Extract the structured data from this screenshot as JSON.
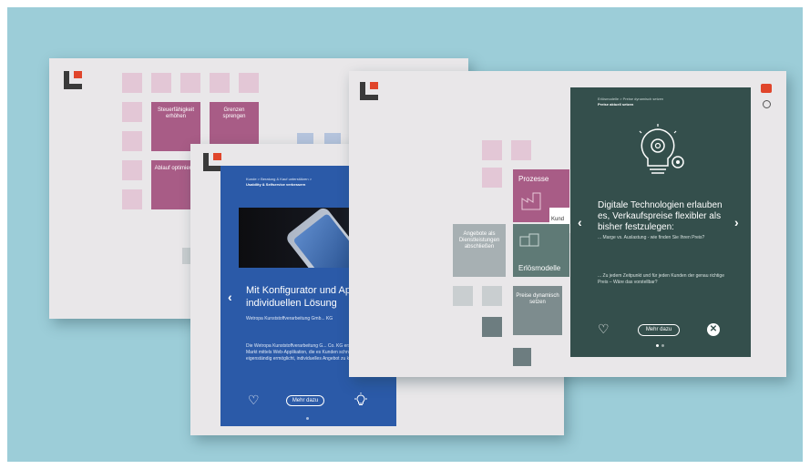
{
  "screen1": {
    "tiles": [
      "Steuerfähigkeit erhöhen",
      "Grenzen sprengen",
      "Ablauf optimieren"
    ]
  },
  "screen2": {
    "breadcrumb": "Kunde  >  Beratung & Kauf unterstützen  >",
    "breadcrumb_current": "Usability & Selfservice verbessern",
    "title": "Mit Konfigurator und App s... zur individuellen Lösung",
    "subtitle": "Wetropa Kunststoffverarbeitung Gmb... KG",
    "body": "Die Wetropa Kunststoffverarbeitung G... Co. KG erschließt den B2C Markt mittels Web-Applikation, die es Kunden schnell, bequem und eigenständig ermöglicht, individuelles Angebot zu konfigurieren...",
    "more_label": "Mehr dazu",
    "nav_prev": "‹"
  },
  "screen3": {
    "tiles": {
      "prozesse": "Prozesse",
      "erloesmodelle": "Erlösmodelle",
      "kunde": "Kund",
      "angebote": "Angebote als Dienstleistungen abschließen",
      "preise": "Preise dynamisch setzen"
    },
    "breadcrumb": "Erlösmodelle  >  Preise dynamisch setzen",
    "breadcrumb_current": "Preise aktuell setzen",
    "title": "Digitale Technologien erlauben es, Verkaufspreise flexibler als bisher festzulegen:",
    "text1": "... Marge vs. Auslastung - wie finden Sie Ihren Preis?",
    "text2": "... Zu jedem Zeitpunkt und für jeden Kunden der genau richtige Preis – Wäre das vorstellbar?",
    "more_label": "Mehr dazu",
    "nav_prev": "‹",
    "nav_next": "›",
    "close": "✕"
  },
  "colors": {
    "background": "#9ccdd8",
    "screen": "#e9e7e9",
    "blue_card": "#2b5aa8",
    "dark_card": "#344f4c",
    "accent": "#e0452b",
    "pink": "#a85c86"
  }
}
